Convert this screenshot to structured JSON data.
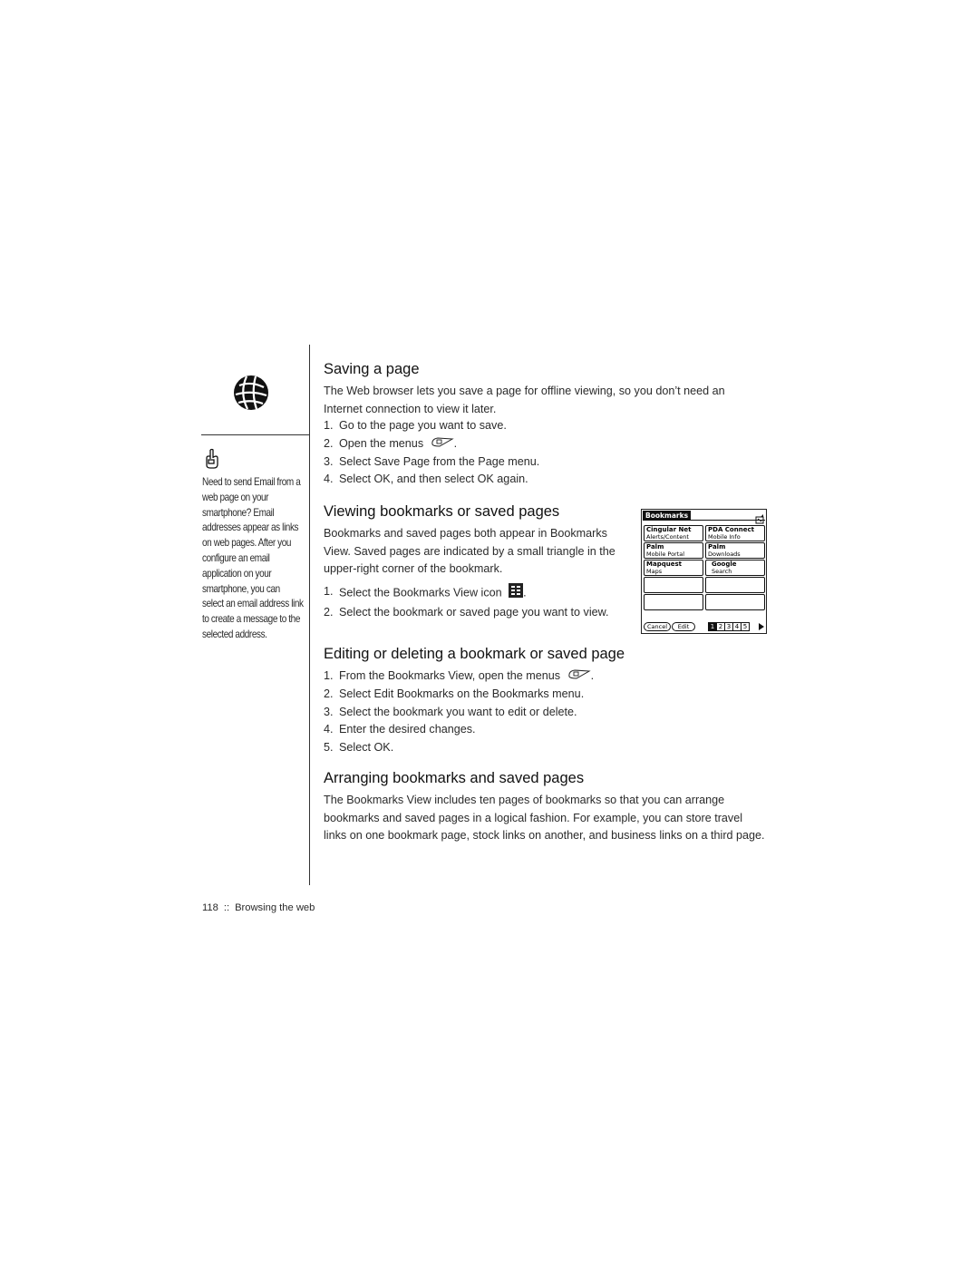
{
  "sidebar": {
    "section_icon": "globe-icon",
    "tip_icon": "pointing-hand-icon",
    "tip_text": "Need to send Email from a web page on your smartphone? Email addresses appear as links on web pages. After you configure an email application on your smartphone, you can select an email address link to create a message to the selected address."
  },
  "sections": [
    {
      "heading": "Saving a page",
      "intro": "The Web browser lets you save a page for offline viewing, so you don’t need an Internet connection to view it later.",
      "steps": [
        {
          "num": "1.",
          "text": "Go to the page you want to save."
        },
        {
          "num": "2.",
          "text": "Open the menus",
          "icon": "menu-key-icon",
          "after": "."
        },
        {
          "num": "3.",
          "text": "Select Save Page from the Page menu."
        },
        {
          "num": "4.",
          "text": "Select OK, and then select OK again."
        }
      ]
    },
    {
      "heading": "Viewing bookmarks or saved pages",
      "intro": "Bookmarks and saved pages both appear in Bookmarks View. Saved pages are indicated by a small triangle in the upper-right corner of the bookmark.",
      "steps": [
        {
          "num": "1.",
          "text": "Select the Bookmarks View icon",
          "icon": "bookmarks-view-icon",
          "after": "."
        },
        {
          "num": "2.",
          "text": "Select the bookmark or saved page you want to view."
        }
      ]
    },
    {
      "heading": "Editing or deleting a bookmark or saved page",
      "steps": [
        {
          "num": "1.",
          "text": "From the Bookmarks View, open the menus",
          "icon": "menu-key-icon",
          "after": "."
        },
        {
          "num": "2.",
          "text": "Select Edit Bookmarks on the Bookmarks menu."
        },
        {
          "num": "3.",
          "text": "Select the bookmark you want to edit or delete."
        },
        {
          "num": "4.",
          "text": "Enter the desired changes."
        },
        {
          "num": "5.",
          "text": "Select OK."
        }
      ]
    },
    {
      "heading": "Arranging bookmarks and saved pages",
      "intro": "The Bookmarks View includes ten pages of bookmarks so that you can arrange bookmarks and saved pages in a logical fashion. For example, you can store travel links on one bookmark page, stock links on another, and business links on a third page."
    }
  ],
  "device_screen": {
    "title": "Bookmarks",
    "corner_icon": "saved-page-icon",
    "bookmarks": [
      {
        "title": "Cingular Net",
        "subtitle": "Alerts/Content"
      },
      {
        "title": "PDA Connect",
        "subtitle": "Mobile Info"
      },
      {
        "title": "Palm",
        "subtitle": "Mobile Portal"
      },
      {
        "title": "Palm",
        "subtitle": "Downloads"
      },
      {
        "title": "Mapquest",
        "subtitle": "Maps"
      },
      {
        "title": "Google",
        "subtitle": "Search"
      },
      {
        "title": "",
        "subtitle": ""
      },
      {
        "title": "",
        "subtitle": ""
      },
      {
        "title": "",
        "subtitle": ""
      },
      {
        "title": "",
        "subtitle": ""
      }
    ],
    "cancel_label": "Cancel",
    "edit_label": "Edit",
    "pages": [
      "1",
      "2",
      "3",
      "4",
      "5"
    ],
    "active_page": "1"
  },
  "footer": {
    "page_number": "118",
    "separator": "::",
    "chapter": "Browsing the web"
  }
}
